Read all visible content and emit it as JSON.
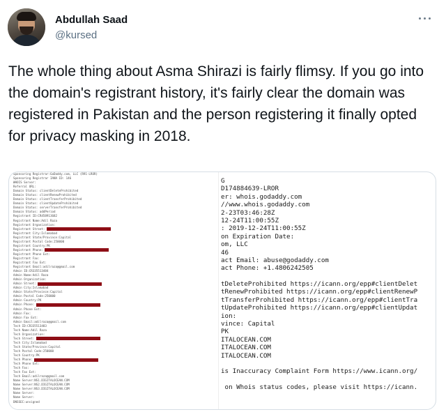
{
  "tweet": {
    "author_name": "Abdullah Saad",
    "author_handle": "@kursed",
    "more_icon": "ellipsis-icon",
    "text": "The whole thing about Asma Shirazi is fairly flimsy. If you go into the domain's registrant history, it's fairly clear the domain was registered in Pakistan and the person registering it finally opted for privacy masking in 2018."
  },
  "media": {
    "left_whois_lines": [
      {
        "text": "Sponsoring Registrar:GoDaddy.com, LLC (R91-LROR)"
      },
      {
        "text": "Sponsoring Registrar IANA ID: 146"
      },
      {
        "text": "WHOIS Server:"
      },
      {
        "text": "Referral URL:"
      },
      {
        "text": "Domain Status: clientDeleteProhibited"
      },
      {
        "text": "Domain Status: clientRenewProhibited"
      },
      {
        "text": "Domain Status: clientTransferProhibited"
      },
      {
        "text": "Domain Status: clientUpdateProhibited"
      },
      {
        "text": "Domain Status: serverTransferProhibited"
      },
      {
        "text": "Domain Status: addPeriod"
      },
      {
        "text": "Registrant ID:CR458913682"
      },
      {
        "text": "Registrant Name:Adil Raza"
      },
      {
        "text": "Registrant Organization:"
      },
      {
        "text": "Registrant Street:",
        "redacted": true
      },
      {
        "text": "Registrant City:Islamabad"
      },
      {
        "text": "Registrant State/Province:Capital"
      },
      {
        "text": "Registrant Postal Code:250000"
      },
      {
        "text": "Registrant Country:PK"
      },
      {
        "text": "Registrant Phone:",
        "redacted": true
      },
      {
        "text": "Registrant Phone Ext:"
      },
      {
        "text": "Registrant Fax:"
      },
      {
        "text": "Registrant Fax Ext:"
      },
      {
        "text": "Registrant Email:adilraza@gmail.com"
      },
      {
        "text": "Admin ID:CR335513484"
      },
      {
        "text": "Admin Name:Adil Raza"
      },
      {
        "text": "Admin Organization:"
      },
      {
        "text": "Admin Street:",
        "redacted": true
      },
      {
        "text": "Admin City:Islamabad"
      },
      {
        "text": "Admin State/Province:Capital"
      },
      {
        "text": "Admin Postal Code:250000"
      },
      {
        "text": "Admin Country:PK"
      },
      {
        "text": "Admin Phone:",
        "redacted": true
      },
      {
        "text": "Admin Phone Ext:"
      },
      {
        "text": "Admin Fax:"
      },
      {
        "text": "Admin Fax Ext:"
      },
      {
        "text": "Admin Email:adilraza@gmail.com"
      },
      {
        "text": "Tech ID:CR335513483"
      },
      {
        "text": "Tech Name:Adil Raza"
      },
      {
        "text": "Tech Organization:"
      },
      {
        "text": "Tech Street:",
        "redacted": true
      },
      {
        "text": "Tech City:Islamabad"
      },
      {
        "text": "Tech State/Province:Capital"
      },
      {
        "text": "Tech Postal Code:250000"
      },
      {
        "text": "Tech Country:PK"
      },
      {
        "text": "Tech Phone:",
        "redacted": true
      },
      {
        "text": "Tech Phone Ext:"
      },
      {
        "text": "Tech Fax:"
      },
      {
        "text": "Tech Fax Ext:"
      },
      {
        "text": "Tech Email:adilraza@gmail.com"
      },
      {
        "text": "Name Server:NS1.DIGITALOCEAN.COM"
      },
      {
        "text": "Name Server:NS2.DIGITALOCEAN.COM"
      },
      {
        "text": "Name Server:NS3.DIGITALOCEAN.COM"
      },
      {
        "text": "Name Server:"
      },
      {
        "text": "Name Server:"
      },
      {
        "text": "DNSSEC:unsigned"
      }
    ],
    "right_whois_lines": [
      "G",
      "D174884639-LROR",
      "er: whois.godaddy.com",
      "//www.whois.godaddy.com",
      "2-23T03:46:28Z",
      "12-24T11:00:55Z",
      ": 2019-12-24T11:00:55Z",
      "on Expiration Date:",
      "om, LLC",
      "46",
      "act Email: abuse@godaddy.com",
      "act Phone: +1.4806242505",
      "",
      "tDeleteProhibited https://icann.org/epp#clientDelet",
      "tRenewProhibited https://icann.org/epp#clientRenewP",
      "tTransferProhibited https://icann.org/epp#clientTra",
      "tUpdateProhibited https://icann.org/epp#clientUpdat",
      "ion:",
      "vince: Capital",
      "PK",
      "ITALOCEAN.COM",
      "ITALOCEAN.COM",
      "ITALOCEAN.COM",
      "",
      "is Inaccuracy Complaint Form https://www.icann.org/",
      "",
      " on Whois status codes, please visit https://icann."
    ],
    "redaction_color": "#8e0e16"
  },
  "colors": {
    "text_primary": "#0f1419",
    "text_secondary": "#5b7083",
    "media_border": "#d6dee5"
  }
}
